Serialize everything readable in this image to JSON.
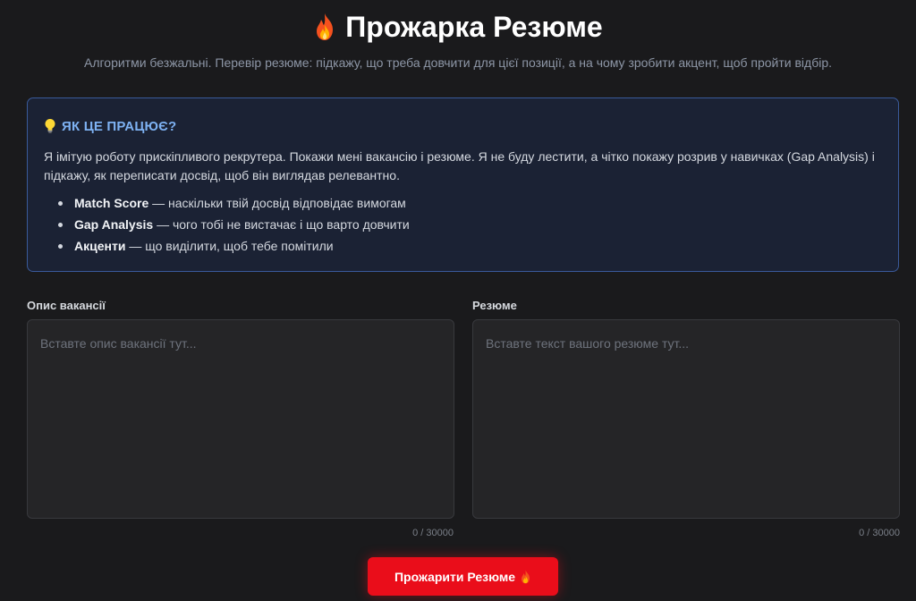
{
  "header": {
    "title": "Прожарка Резюме",
    "title_icon": "fire-icon",
    "subtitle": "Алгоритми безжальні. Перевір резюме: підкажу, що треба довчити для цієї позиції, а на чому зробити акцент, щоб пройти відбір."
  },
  "info": {
    "icon": "lightbulb-icon",
    "heading": "ЯК ЦЕ ПРАЦЮЄ?",
    "text": "Я імітую роботу прискіпливого рекрутера. Покажи мені вакансію і резюме. Я не буду лестити, а чітко покажу розрив у навичках (Gap Analysis) і підкажу, як переписати досвід, щоб він виглядав релевантно.",
    "items": [
      {
        "term": "Match Score",
        "desc": " — наскільки твій досвід відповідає вимогам"
      },
      {
        "term": "Gap Analysis",
        "desc": " — чого тобі не вистачає і що варто довчити"
      },
      {
        "term": "Акценти",
        "desc": " — що виділити, щоб тебе помітили"
      }
    ]
  },
  "form": {
    "job": {
      "label": "Опис вакансії",
      "value": "",
      "placeholder": "Вставте опис вакансії тут...",
      "counter": "0 / 30000"
    },
    "resume": {
      "label": "Резюме",
      "value": "",
      "placeholder": "Вставте текст вашого резюме тут...",
      "counter": "0 / 30000"
    },
    "submit_label": "Прожарити Резюме",
    "submit_icon": "fire-icon"
  },
  "colors": {
    "background": "#1a1a1c",
    "accent_red": "#ea0d1a",
    "info_border": "#3a5a9a",
    "info_heading": "#7eb2f3"
  }
}
